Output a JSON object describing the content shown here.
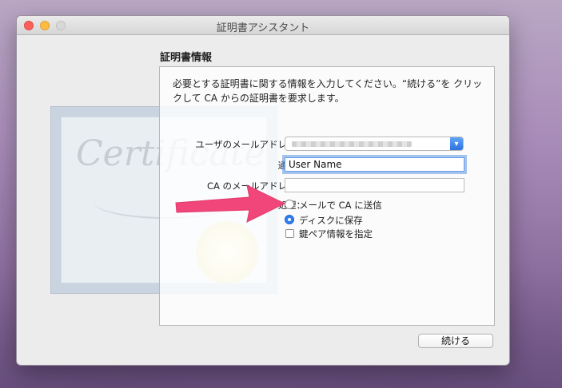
{
  "window": {
    "title": "証明書アシスタント"
  },
  "certificate_art": {
    "word": "Certificate"
  },
  "section": {
    "title": "証明書情報"
  },
  "description": "必要とする証明書に関する情報を入力してください。“続ける”を クリックして CA からの証明書を要求します。",
  "form": {
    "user_email_label": "ユーザのメールアドレス：",
    "common_name_label": "通称：",
    "common_name_value": "User Name",
    "ca_email_label": "CA のメールアドレス：",
    "ca_email_value": "",
    "request_label": "要求の処理：",
    "options": [
      {
        "label": "メールで CA に送信",
        "selected": false
      },
      {
        "label": "ディスクに保存",
        "selected": true
      }
    ],
    "keypair_label": "鍵ペア情報を指定",
    "keypair_checked": false
  },
  "buttons": {
    "continue": "続ける"
  },
  "colors": {
    "accent": "#2f7ef2",
    "arrow": "#f0467a"
  }
}
